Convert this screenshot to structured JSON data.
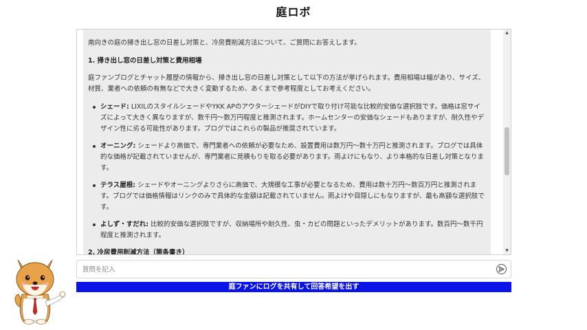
{
  "app": {
    "title": "庭ロボ"
  },
  "chat": {
    "intro": "南向きの庭の掃き出し窓の日差し対策と、冷房費削減方法について、ご質問にお答えします。",
    "section1_heading": "1. 掃き出し窓の日差し対策と費用相場",
    "section1_intro": "庭ファンブログとチャット履歴の情報から、掃き出し窓の日差し対策として以下の方法が挙げられます。費用相場は幅があり、サイズ、材質、業者への依頼の有無などで大きく変動するため、あくまで参考程度としてお考えください。",
    "items": [
      {
        "term": "シェード:",
        "text": " LIXILのスタイルシェードやYKK APのアウターシェードがDIYで取り付け可能な比較的安価な選択肢です。価格は窓サイズによって大きく異なりますが、数千円～数万円程度と推測されます。ホームセンターの安価なシェードもありますが、耐久性やデザイン性に劣る可能性があります。ブログではこれらの製品が推奨されています。"
      },
      {
        "term": "オーニング:",
        "text": " シェードより高価で、専門業者への依頼が必要なため、設置費用は数万円～数十万円と推測されます。ブログでは具体的な価格が記載されていませんが、専門業者に見積もりを取る必要があります。雨よけにもなり、より本格的な日差し対策となります。"
      },
      {
        "term": "テラス屋根:",
        "text": " シェードやオーニングよりさらに高価で、大規模な工事が必要となるため、費用は数十万円～数百万円と推測されます。ブログでは価格情報はリンクのみで具体的な金額は記載されていません。雨よけや目隠しにもなりますが、最も高額な選択肢です。"
      },
      {
        "term": "よしず・すだれ:",
        "text": " 比較的安価な選択肢ですが、収納場所や耐久性、虫・カビの問題といったデメリットがあります。数百円～数千円程度と推測されます。"
      }
    ],
    "section2_heading": "2. 冷房費用削減方法（箇条書き）"
  },
  "input": {
    "placeholder": "質問を記入",
    "value": ""
  },
  "actions": {
    "submit_label": "庭ファンにログを共有して回答希望を出す"
  },
  "colors": {
    "accent": "#0b14e6",
    "chat_bg": "#ececec"
  },
  "icons": {
    "send": "send-icon",
    "mascot": "shiba-dog-mascot"
  }
}
